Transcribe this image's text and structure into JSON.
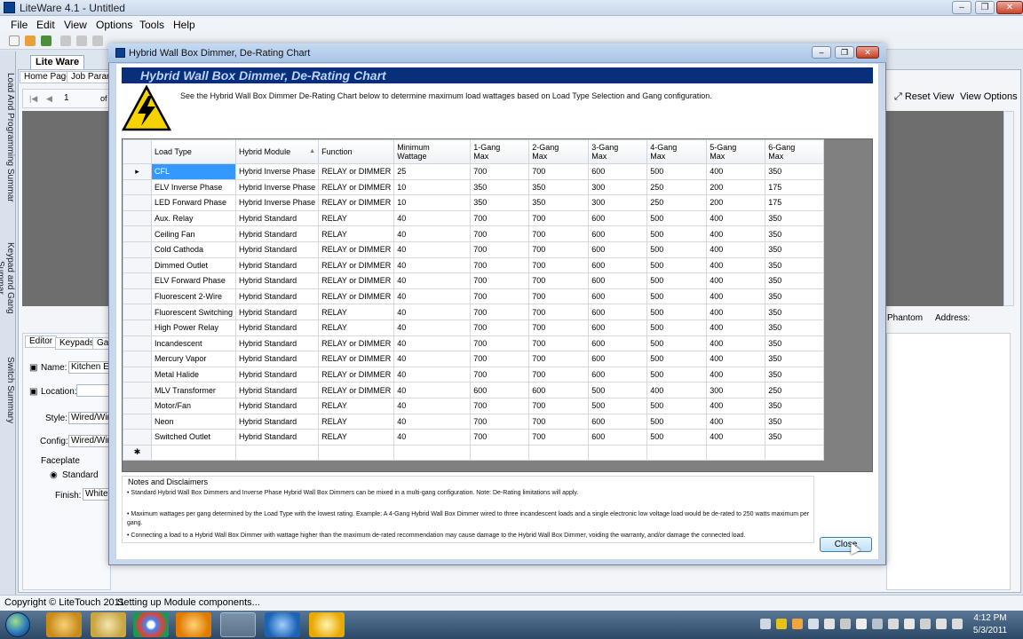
{
  "app": {
    "title": "LiteWare 4.1 - Untitled",
    "menu": [
      "File",
      "Edit",
      "View",
      "Options",
      "Tools",
      "Help"
    ],
    "doc_tab": "Lite Ware",
    "subtabs": [
      "Home Page",
      "Job Parame"
    ],
    "nav_page": "1",
    "nav_of": "of",
    "reset_view": "Reset View",
    "view_options": "View Options",
    "phantom": "Phantom",
    "address": "Address:",
    "side_tabs": [
      "Load And Programming Summar",
      "Keypad and Gang Summar",
      "Switch Summary"
    ],
    "editor_tabs": [
      "Editor",
      "Keypads",
      "Ga"
    ],
    "editor": {
      "name_label": "Name:",
      "name_value": "Kitchen En",
      "location_label": "Location:",
      "style_label": "Style:",
      "style_value": "Wired/Wir",
      "config_label": "Config:",
      "config_value": "Wired/Wir",
      "faceplate_label": "Faceplate",
      "standard_label": "Standard",
      "finish_label": "Finish:",
      "finish_value": "White"
    },
    "status": {
      "copyright": "Copyright © LiteTouch 2011",
      "message": "Setting up Module components..."
    },
    "clock": {
      "time": "4:12 PM",
      "date": "5/3/2011"
    }
  },
  "dialog": {
    "title": "Hybrid Wall Box Dimmer, De-Rating Chart",
    "banner": "Hybrid Wall Box Dimmer, De-Rating Chart",
    "intro": "See the Hybrid Wall Box Dimmer De-Rating Chart below to determine maximum load wattages  based on Load Type Selection and Gang configuration.",
    "columns": [
      "Load Type",
      "Hybrid Module",
      "Function",
      "Minimum\nWattage",
      "1-Gang\nMax",
      "2-Gang\nMax",
      "3-Gang\nMax",
      "4-Gang\nMax",
      "5-Gang\nMax",
      "6-Gang\nMax"
    ],
    "rows": [
      [
        "CFL",
        "Hybrid Inverse Phase",
        "RELAY or DIMMER",
        "25",
        "700",
        "700",
        "600",
        "500",
        "400",
        "350"
      ],
      [
        "ELV Inverse Phase",
        "Hybrid Inverse Phase",
        "RELAY or DIMMER",
        "10",
        "350",
        "350",
        "300",
        "250",
        "200",
        "175"
      ],
      [
        "LED Forward Phase",
        "Hybrid Inverse Phase",
        "RELAY or DIMMER",
        "10",
        "350",
        "350",
        "300",
        "250",
        "200",
        "175"
      ],
      [
        "Aux. Relay",
        "Hybrid Standard",
        "RELAY",
        "40",
        "700",
        "700",
        "600",
        "500",
        "400",
        "350"
      ],
      [
        "Ceiling Fan",
        "Hybrid Standard",
        "RELAY",
        "40",
        "700",
        "700",
        "600",
        "500",
        "400",
        "350"
      ],
      [
        "Cold Cathoda",
        "Hybrid Standard",
        "RELAY or DIMMER",
        "40",
        "700",
        "700",
        "600",
        "500",
        "400",
        "350"
      ],
      [
        "Dimmed Outlet",
        "Hybrid Standard",
        "RELAY or DIMMER",
        "40",
        "700",
        "700",
        "600",
        "500",
        "400",
        "350"
      ],
      [
        "ELV Forward Phase",
        "Hybrid Standard",
        "RELAY or DIMMER",
        "40",
        "700",
        "700",
        "600",
        "500",
        "400",
        "350"
      ],
      [
        "Fluorescent 2-Wire",
        "Hybrid Standard",
        "RELAY or DIMMER",
        "40",
        "700",
        "700",
        "600",
        "500",
        "400",
        "350"
      ],
      [
        "Fluorescent Switching",
        "Hybrid Standard",
        "RELAY",
        "40",
        "700",
        "700",
        "600",
        "500",
        "400",
        "350"
      ],
      [
        "High Power Relay",
        "Hybrid Standard",
        "RELAY",
        "40",
        "700",
        "700",
        "600",
        "500",
        "400",
        "350"
      ],
      [
        "Incandescent",
        "Hybrid Standard",
        "RELAY or DIMMER",
        "40",
        "700",
        "700",
        "600",
        "500",
        "400",
        "350"
      ],
      [
        "Mercury Vapor",
        "Hybrid Standard",
        "RELAY or DIMMER",
        "40",
        "700",
        "700",
        "600",
        "500",
        "400",
        "350"
      ],
      [
        "Metal Halide",
        "Hybrid Standard",
        "RELAY or DIMMER",
        "40",
        "700",
        "700",
        "600",
        "500",
        "400",
        "350"
      ],
      [
        "MLV Transformer",
        "Hybrid Standard",
        "RELAY or DIMMER",
        "40",
        "600",
        "600",
        "500",
        "400",
        "300",
        "250"
      ],
      [
        "Motor/Fan",
        "Hybrid Standard",
        "RELAY",
        "40",
        "700",
        "700",
        "500",
        "500",
        "400",
        "350"
      ],
      [
        "Neon",
        "Hybrid Standard",
        "RELAY",
        "40",
        "700",
        "700",
        "600",
        "500",
        "400",
        "350"
      ],
      [
        "Switched Outlet",
        "Hybrid Standard",
        "RELAY",
        "40",
        "700",
        "700",
        "600",
        "500",
        "400",
        "350"
      ]
    ],
    "notes_title": "Notes and Disclaimers",
    "notes": [
      "• Standard Hybrid Wall Box Dimmers and Inverse Phase Hybrid Wall Box Dimmers can be mixed in a multi-gang configuration.  Note: De-Rating limitations will apply.",
      "• Maximum wattages per gang determined by the Load Type with the lowest rating.  Example: A 4-Gang Hybrid Wall Box Dimmer wired to three incandescent loads and a single electronic low voltage load would be de-rated to 250 watts maximum per gang.",
      "• Connecting a load to a Hybrid Wall Box Dimmer with wattage higher than the maximum de-rated recommendation may cause damage to the Hybrid Wall Box Dimmer, voiding the warranty, and/or damage the connected load."
    ],
    "close_label": "Close"
  }
}
